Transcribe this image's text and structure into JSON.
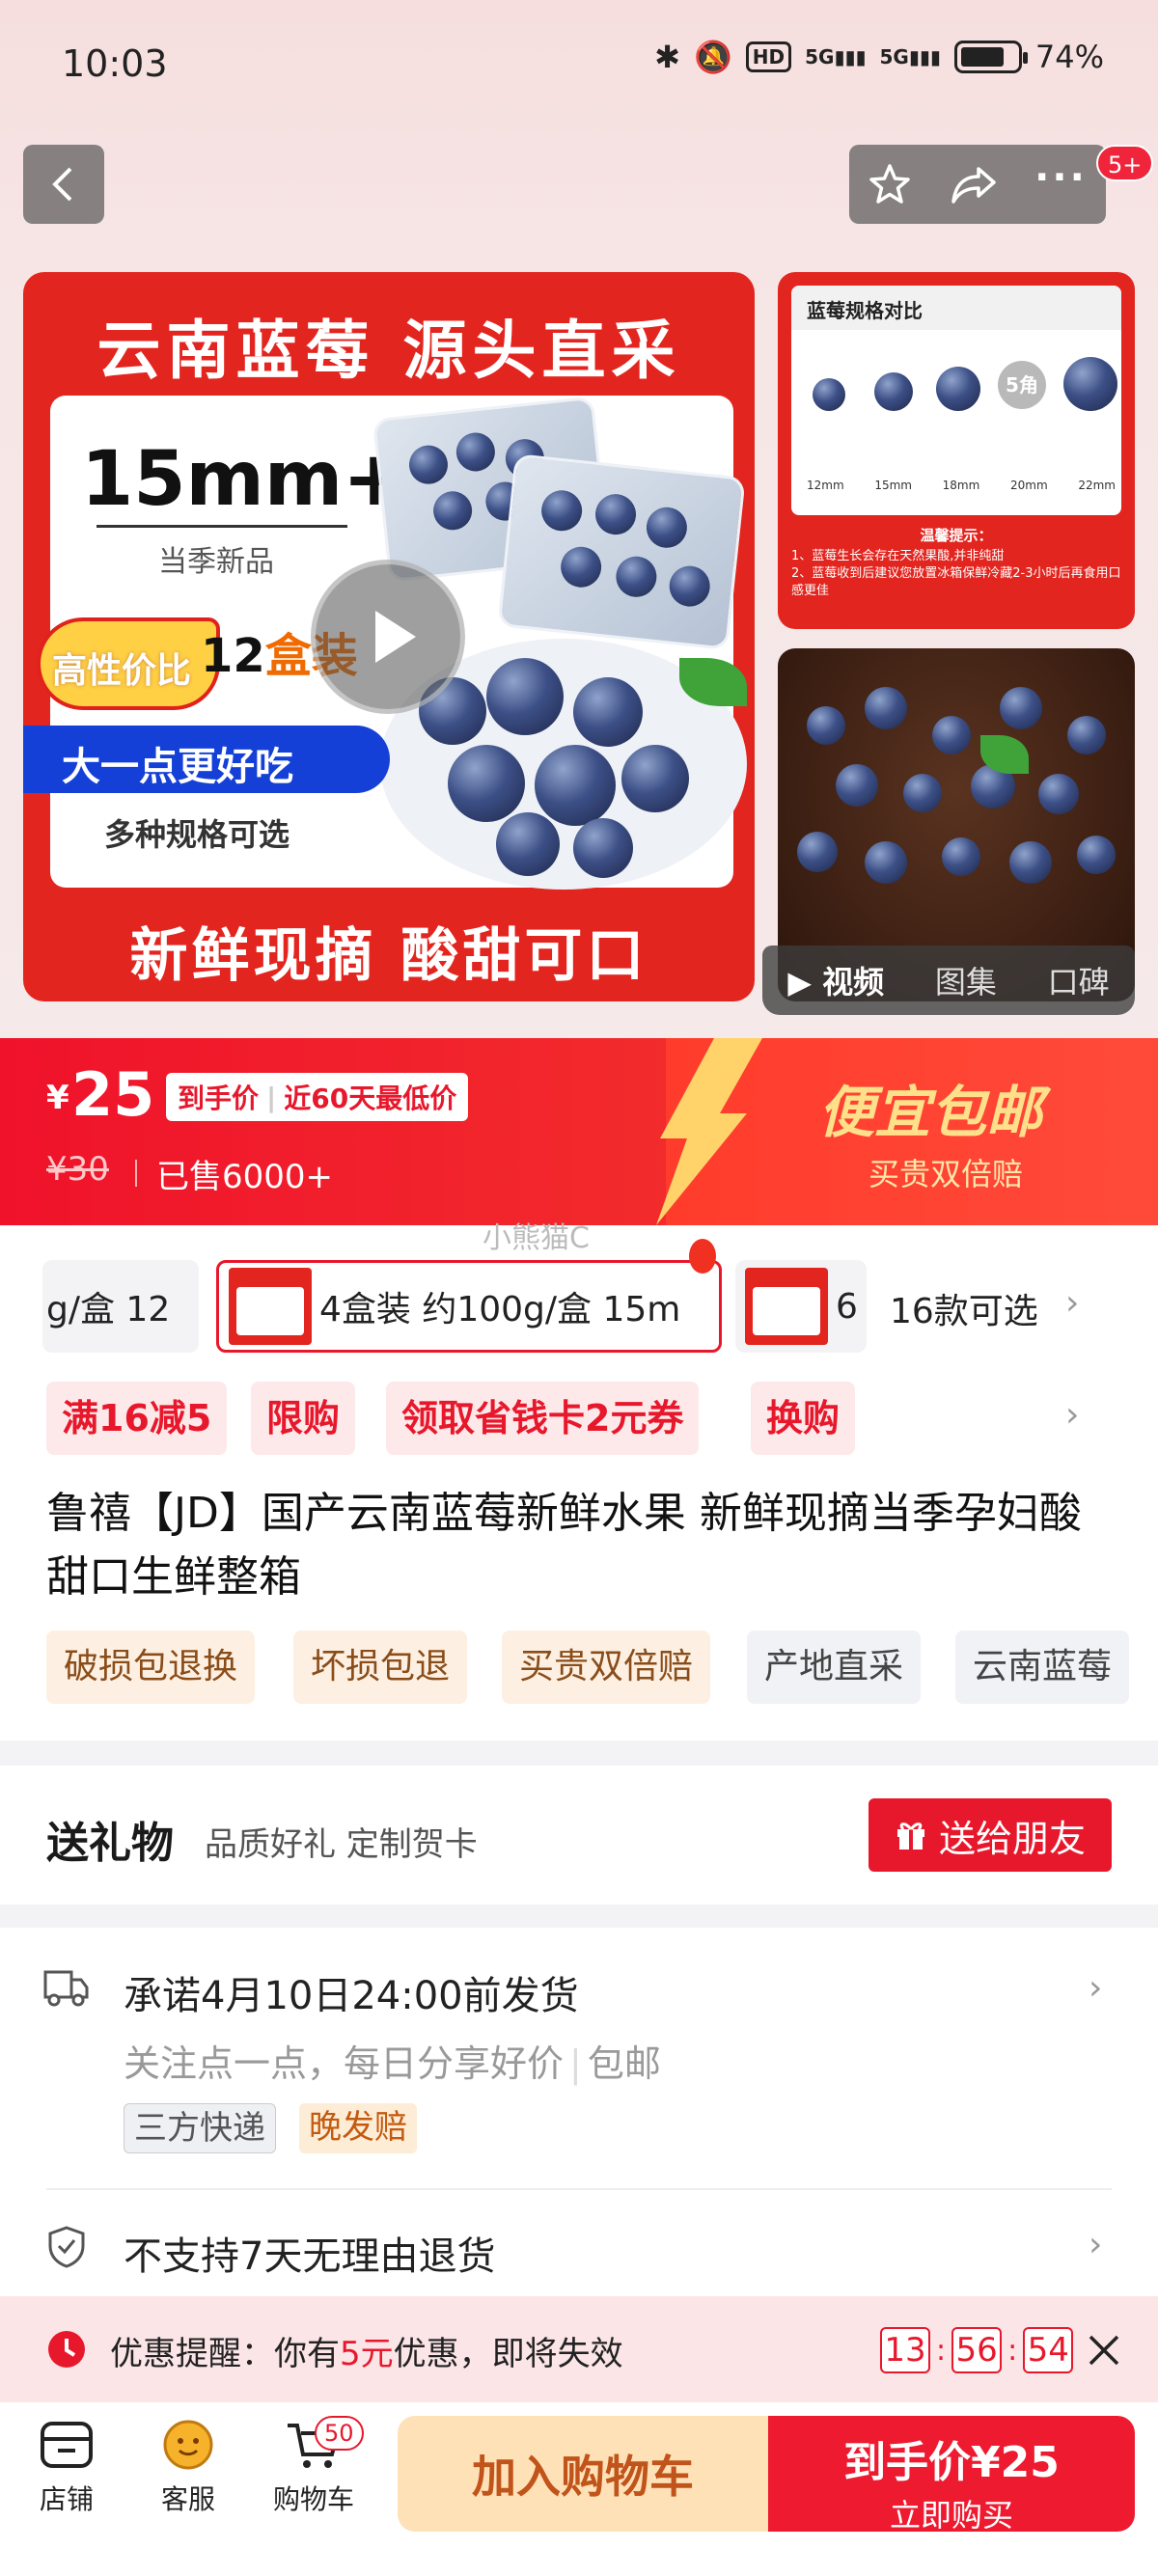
{
  "status_bar": {
    "time": "10:03",
    "network": "5G",
    "network2": "5G",
    "hd": "HD",
    "battery": "74%"
  },
  "nav": {
    "badge": "5+"
  },
  "main_image": {
    "title": "云南蓝莓 源头直采",
    "size": "15mm+",
    "subtitle": "当季新品",
    "value_label": "高性价比",
    "box_count_a": "12",
    "box_count_b": "盒装",
    "bigger": "大一点更好吃",
    "multi": "多种规格可选",
    "footer": "新鲜现摘 酸甜可口"
  },
  "compare_image": {
    "header": "蓝莓规格对比",
    "sizes": [
      "12mm",
      "15mm",
      "18mm",
      "20mm",
      "22mm"
    ],
    "coin": "5角",
    "tip_title": "温馨提示：",
    "tip_1": "1、蓝莓生长会存在天然果酸,并非纯甜",
    "tip_2": "2、蓝莓收到后建议您放置冰箱保鲜冷藏2-3小时后再食用口感更佳"
  },
  "media_tabs": {
    "video": "视频",
    "gallery": "图集",
    "reviews": "口碑"
  },
  "price": {
    "yen": "¥",
    "value": "25",
    "tag": "到手价",
    "tag2": "近60天最低价",
    "old": "¥30",
    "sold": "已售6000+",
    "promo_big": "便宜包邮",
    "promo_small": "买贵双倍赔"
  },
  "watermark": "小熊猫C",
  "skus": {
    "left": "g/盒 12",
    "selected": "4盒装 约100g/盒 15m",
    "right_num": "6",
    "more": "16款可选"
  },
  "promos": [
    "满16减5",
    "限购",
    "领取省钱卡2元券",
    "换购"
  ],
  "product_title": "鲁禧【JD】国产云南蓝莓新鲜水果 新鲜现摘当季孕妇酸甜口生鲜整箱",
  "features": [
    "破损包退换",
    "坏损包退",
    "买贵双倍赔",
    "产地直采",
    "云南蓝莓"
  ],
  "gift": {
    "title": "送礼物",
    "desc": "品质好礼 定制贺卡",
    "button": "送给朋友"
  },
  "delivery": {
    "promise": "承诺4月10日24:00前发货",
    "follow": "关注点一点，每日分享好价",
    "free_ship": "包邮",
    "tag_express": "三方快递",
    "tag_late": "晚发赔",
    "no_return": "不支持7天无理由退货"
  },
  "reminder": {
    "prefix": "优惠提醒：你有",
    "amount": "5元",
    "suffix": "优惠，即将失效",
    "h": "13",
    "m": "56",
    "s": "54"
  },
  "bottom": {
    "store": "店铺",
    "service": "客服",
    "cart": "购物车",
    "cart_count": "50",
    "add_cart": "加入购物车",
    "buy_price": "到手价¥25",
    "buy_now": "立即购买"
  },
  "colors": {
    "accent": "#e8182c",
    "price_band": "#f0122b",
    "cart_button": "#ffe1b8"
  }
}
